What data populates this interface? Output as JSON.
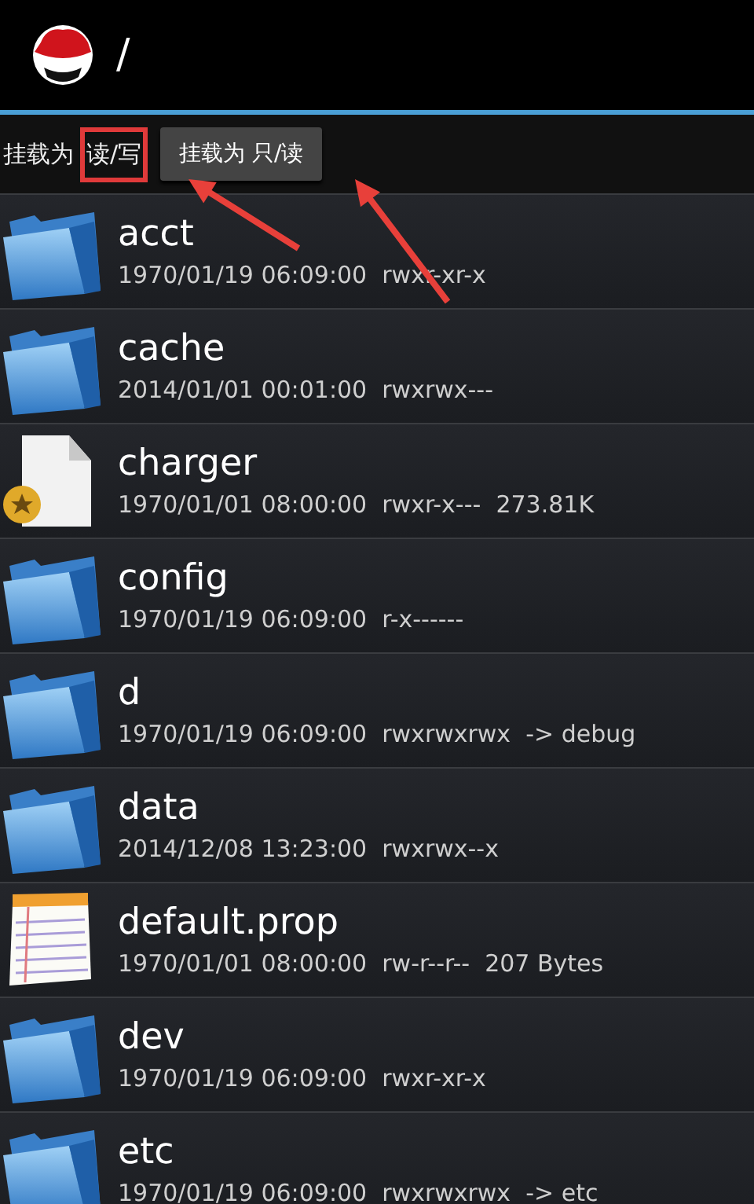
{
  "header": {
    "path": "/"
  },
  "mount_bar": {
    "label": "挂载为",
    "current": "读/写",
    "current_highlighted": true,
    "button": "挂载为 只/读"
  },
  "annotations": [
    {
      "kind": "arrow"
    },
    {
      "kind": "arrow"
    }
  ],
  "files": [
    {
      "kind": "folder",
      "name": "acct",
      "details": "1970/01/19 06:09:00  rwxr-xr-x"
    },
    {
      "kind": "folder",
      "name": "cache",
      "details": "2014/01/01 00:01:00  rwxrwx---"
    },
    {
      "kind": "binary",
      "name": "charger",
      "details": "1970/01/01 08:00:00  rwxr-x---  273.81K"
    },
    {
      "kind": "folder",
      "name": "config",
      "details": "1970/01/19 06:09:00  r-x------"
    },
    {
      "kind": "folder",
      "name": "d",
      "details": "1970/01/19 06:09:00  rwxrwxrwx  -> debug"
    },
    {
      "kind": "folder",
      "name": "data",
      "details": "2014/12/08 13:23:00  rwxrwx--x"
    },
    {
      "kind": "text",
      "name": "default.prop",
      "details": "1970/01/01 08:00:00  rw-r--r--  207 Bytes"
    },
    {
      "kind": "folder",
      "name": "dev",
      "details": "1970/01/19 06:09:00  rwxr-xr-x"
    },
    {
      "kind": "folder",
      "name": "etc",
      "details": "1970/01/19 06:09:00  rwxrwxrwx  -> etc"
    }
  ]
}
